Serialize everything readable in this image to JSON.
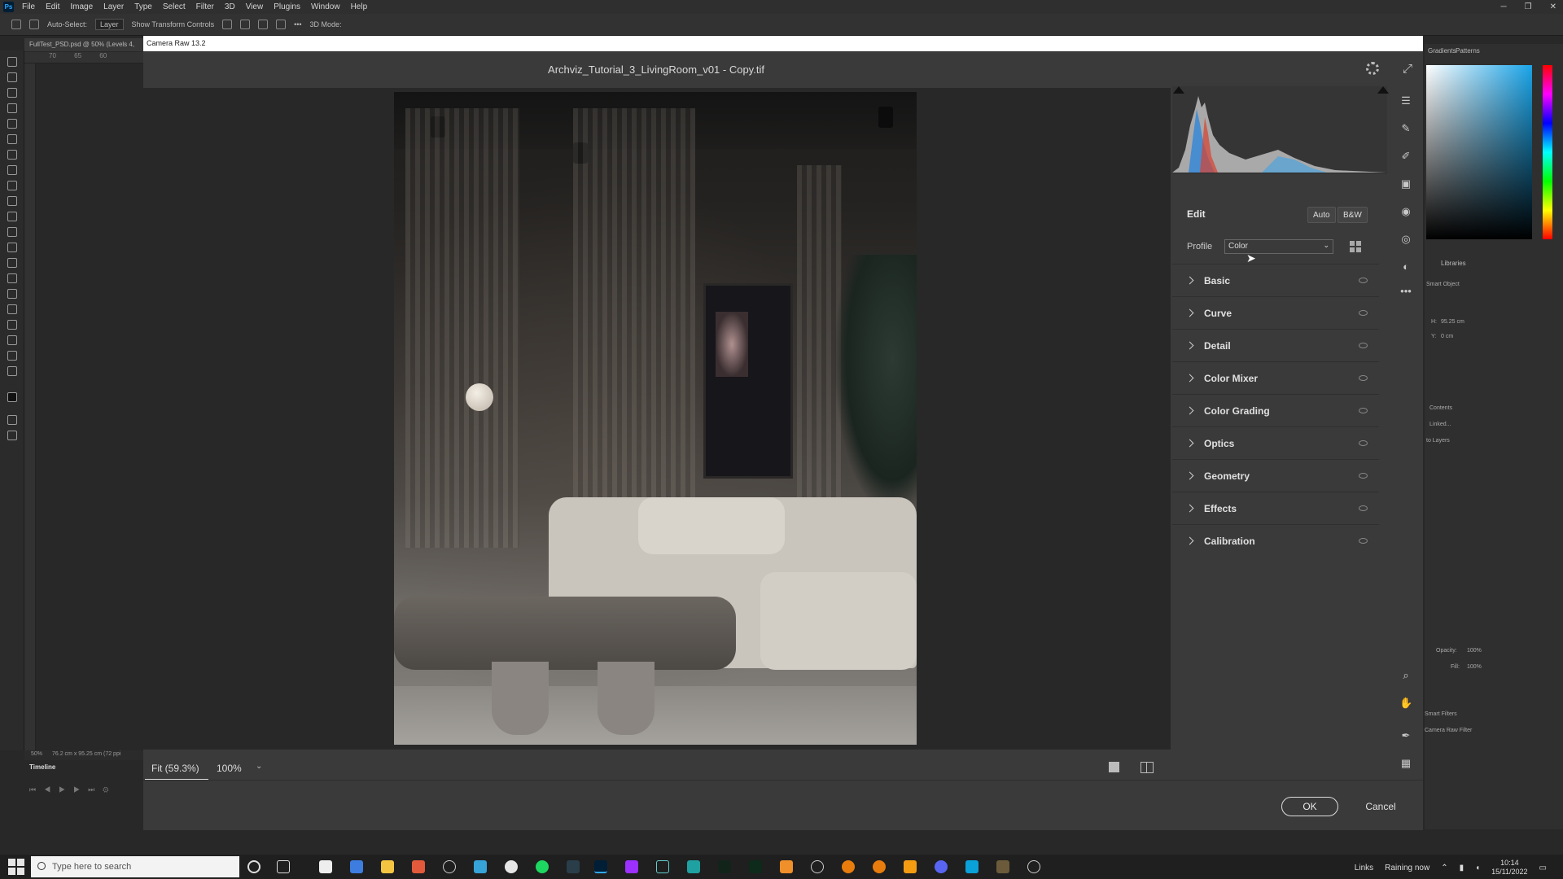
{
  "ps": {
    "menu": [
      "File",
      "Edit",
      "Image",
      "Layer",
      "Type",
      "Select",
      "Filter",
      "3D",
      "View",
      "Plugins",
      "Window",
      "Help"
    ],
    "options": {
      "auto_select": "Auto-Select:",
      "layer": "Layer",
      "transform": "Show Transform Controls",
      "mode": "3D Mode:"
    },
    "doc_tab": "FullTest_PSD.psd @ 50% (Levels 4,",
    "ruler": "70 65 60",
    "status_zoom": "50%",
    "status_size": "76.2 cm x 95.25 cm (72 ppi",
    "timeline": "Timeline",
    "right_panel": {
      "tabs": [
        "Gradients",
        "Patterns"
      ],
      "tabs2": [
        "Libraries"
      ],
      "props_title": "Smart Object",
      "w_label": "H:",
      "w_value": "95.25 cm",
      "y_label": "Y:",
      "y_value": "0 cm",
      "btns": [
        "Contents",
        "Linked...",
        "to Layers"
      ],
      "layers_opacity_label": "Opacity:",
      "layers_opacity": "100%",
      "layers_fill_label": "Fill:",
      "layers_fill": "100%",
      "filters": [
        "Smart Filters",
        "Camera Raw Filter"
      ]
    }
  },
  "cr": {
    "window_title": "Camera Raw 13.2",
    "filename": "Archviz_Tutorial_3_LivingRoom_v01 - Copy.tif",
    "zoom_fit": "Fit (59.3%)",
    "zoom_pct": "100%",
    "edit_title": "Edit",
    "auto_label": "Auto",
    "bw_label": "B&W",
    "profile_label": "Profile",
    "profile_value": "Color",
    "sections": [
      "Basic",
      "Curve",
      "Detail",
      "Color Mixer",
      "Color Grading",
      "Optics",
      "Geometry",
      "Effects",
      "Calibration"
    ],
    "ok_label": "OK",
    "cancel_label": "Cancel"
  },
  "taskbar": {
    "search_placeholder": "Type here to search",
    "links": "Links",
    "weather": "Raining now",
    "time": "10:14",
    "date": "15/11/2022"
  },
  "icons": {
    "cr_settings": "gear-icon",
    "cr_fullscreen": "expand-icon",
    "cr_tools": [
      "edit-sliders-icon",
      "healing-icon",
      "brush-icon",
      "gradient-icon",
      "radial-icon",
      "red-eye-icon",
      "presets-icon",
      "more-icon",
      "zoom-icon",
      "hand-icon",
      "sampler-icon",
      "grid-icon"
    ]
  },
  "colors": {
    "cr_bg": "#3a3a3a",
    "ps_bg": "#2b2b2b",
    "accent_ok_border": "#dcdcdc"
  }
}
